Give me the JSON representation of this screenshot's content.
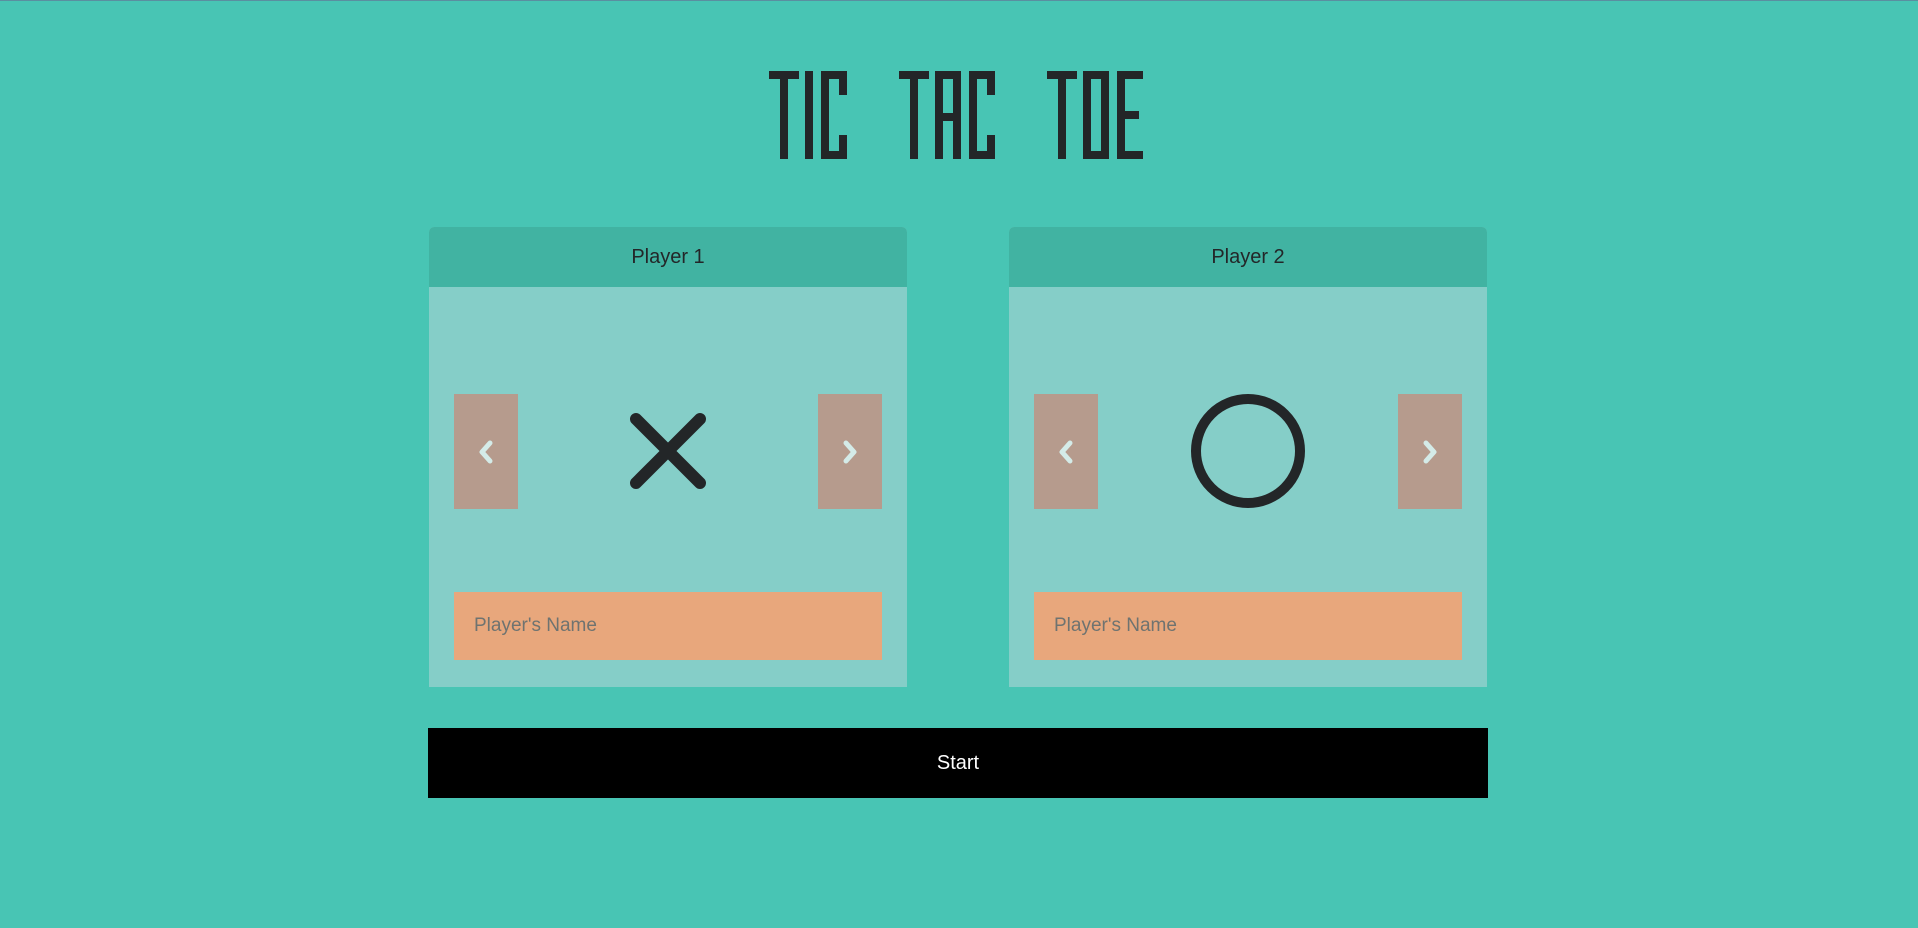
{
  "title": "TIC TAC TOE",
  "players": [
    {
      "label": "Player 1",
      "symbol_icon": "x-icon",
      "name_placeholder": "Player's Name",
      "name_value": ""
    },
    {
      "label": "Player 2",
      "symbol_icon": "o-icon",
      "name_placeholder": "Player's Name",
      "name_value": ""
    }
  ],
  "start_label": "Start",
  "icons": {
    "prev": "chevron-left-icon",
    "next": "chevron-right-icon"
  },
  "colors": {
    "background": "#48c5b4",
    "card_body": "#85cec8",
    "card_header": "#41b3a2",
    "arrow_button": "#b69b8d",
    "input_bg": "#e8a77c",
    "symbol": "#232628",
    "start_bg": "#000000"
  }
}
